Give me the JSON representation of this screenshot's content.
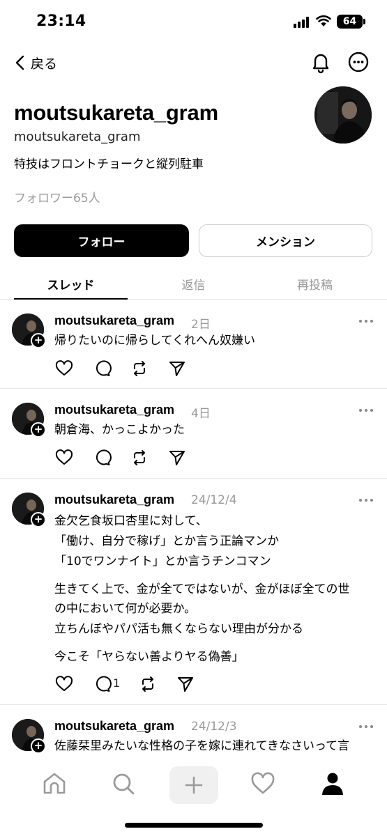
{
  "status_bar": {
    "time": "23:14",
    "battery": "64"
  },
  "nav": {
    "back_label": "戻る"
  },
  "profile": {
    "name": "moutsukareta_gram",
    "handle": "moutsukareta_gram",
    "bio": "特技はフロントチョークと縦列駐車",
    "followers": "フォロワー65人",
    "follow_label": "フォロー",
    "mention_label": "メンション"
  },
  "tabs": [
    {
      "label": "スレッド",
      "active": true
    },
    {
      "label": "返信",
      "active": false
    },
    {
      "label": "再投稿",
      "active": false
    }
  ],
  "posts": [
    {
      "user": "moutsukareta_gram",
      "time": "2日",
      "lines": [
        "帰りたいのに帰らしてくれへん奴嫌い"
      ],
      "reply_count": ""
    },
    {
      "user": "moutsukareta_gram",
      "time": "4日",
      "lines": [
        "朝倉海、かっこよかった"
      ],
      "reply_count": ""
    },
    {
      "user": "moutsukareta_gram",
      "time": "24/12/4",
      "lines": [
        "金欠乞食坂口杏里に対して、",
        "「働け、自分で稼げ」とか言う正論マンか",
        "「10でワンナイト」とか言うチンコマン",
        "生きてく上で、金が全てではないが、金がほぼ全ての世",
        "の中において何が必要か。",
        "立ちんぼやパパ活も無くならない理由が分かる",
        "今こそ「ヤらない善よりヤる偽善」"
      ],
      "reply_count": "1"
    },
    {
      "user": "moutsukareta_gram",
      "time": "24/12/3",
      "lines": [
        "佐藤栞里みたいな性格の子を嫁に連れてきなさいって言"
      ],
      "reply_count": ""
    }
  ],
  "bottom_nav": [
    "home-icon",
    "search-icon",
    "plus-icon",
    "heart-icon",
    "profile-icon"
  ]
}
